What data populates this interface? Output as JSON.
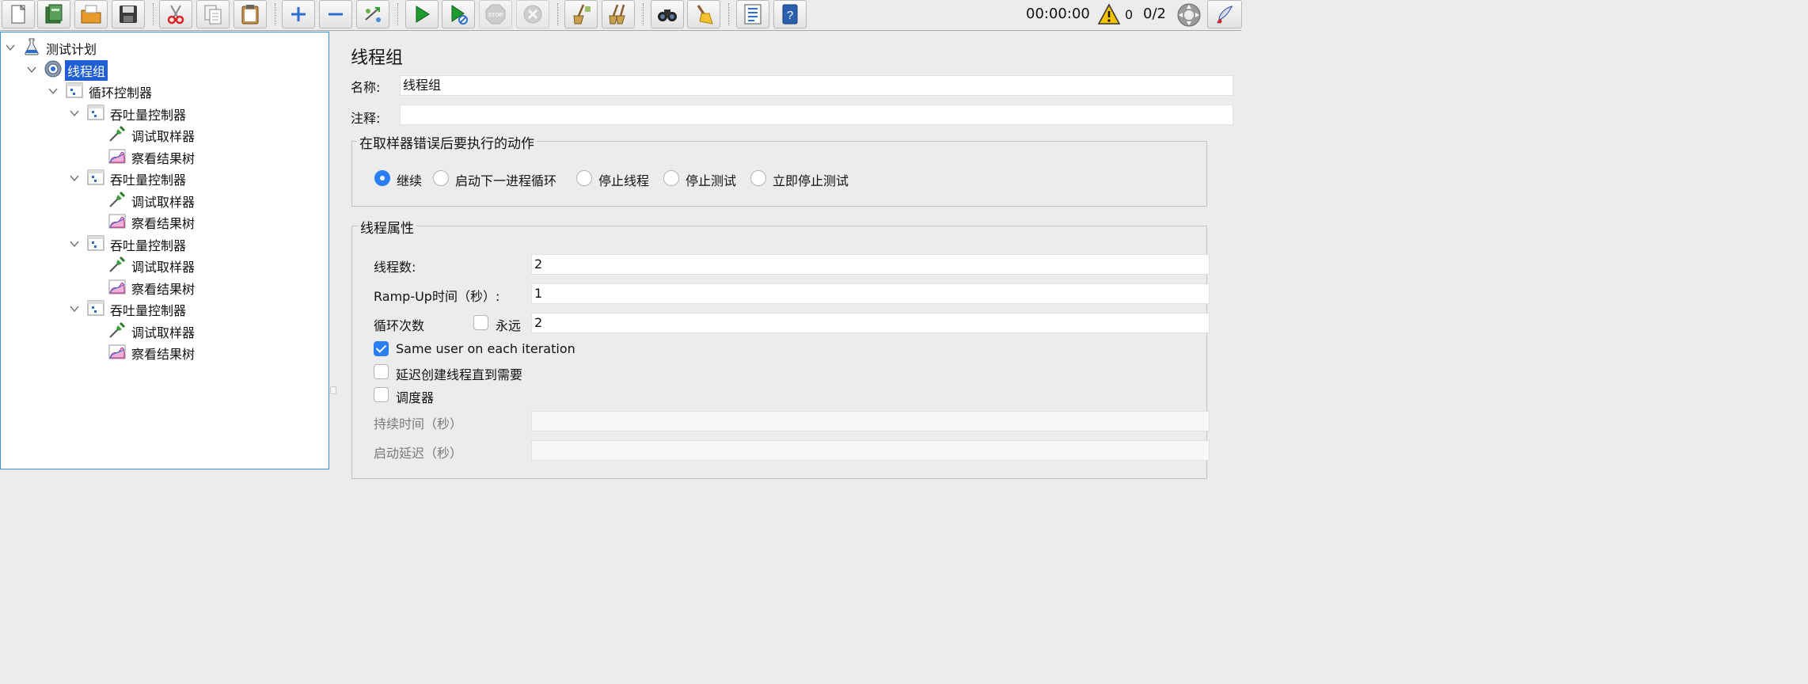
{
  "toolbar": {
    "buttons": [
      {
        "name": "new-icon"
      },
      {
        "name": "templates-icon"
      },
      {
        "name": "open-icon"
      },
      {
        "name": "save-icon"
      },
      {
        "name": "cut-icon"
      },
      {
        "name": "copy-icon"
      },
      {
        "name": "paste-icon"
      },
      {
        "name": "expand-icon"
      },
      {
        "name": "collapse-icon"
      },
      {
        "name": "toggle-icon"
      },
      {
        "name": "start-icon"
      },
      {
        "name": "start-no-pauses-icon"
      },
      {
        "name": "stop-icon",
        "label": "STOP",
        "disabled": true
      },
      {
        "name": "shutdown-icon",
        "disabled": true
      },
      {
        "name": "clear-icon"
      },
      {
        "name": "clear-all-icon"
      },
      {
        "name": "search-icon"
      },
      {
        "name": "reset-search-icon"
      },
      {
        "name": "function-helper-icon"
      },
      {
        "name": "help-icon"
      }
    ],
    "timer": "00:00:00",
    "warning_count": "0",
    "threads": "0/2"
  },
  "tree": {
    "nodes": [
      {
        "label": "测试计划",
        "icon": "test-plan-icon",
        "expanded": true
      },
      {
        "label": "线程组",
        "icon": "thread-group-icon",
        "expanded": true,
        "selected": true
      },
      {
        "label": "循环控制器",
        "icon": "controller-icon",
        "expanded": true
      },
      {
        "label": "吞吐量控制器",
        "icon": "controller-icon",
        "expanded": true
      },
      {
        "label": "调试取样器",
        "icon": "sampler-icon"
      },
      {
        "label": "察看结果树",
        "icon": "listener-icon"
      },
      {
        "label": "吞吐量控制器",
        "icon": "controller-icon",
        "expanded": true
      },
      {
        "label": "调试取样器",
        "icon": "sampler-icon"
      },
      {
        "label": "察看结果树",
        "icon": "listener-icon"
      },
      {
        "label": "吞吐量控制器",
        "icon": "controller-icon",
        "expanded": true
      },
      {
        "label": "调试取样器",
        "icon": "sampler-icon"
      },
      {
        "label": "察看结果树",
        "icon": "listener-icon"
      },
      {
        "label": "吞吐量控制器",
        "icon": "controller-icon",
        "expanded": true
      },
      {
        "label": "调试取样器",
        "icon": "sampler-icon"
      },
      {
        "label": "察看结果树",
        "icon": "listener-icon"
      }
    ]
  },
  "main": {
    "title": "线程组",
    "name_label": "名称:",
    "name_value": "线程组",
    "comment_label": "注释:",
    "comment_value": "",
    "error_group": {
      "title": "在取样器错误后要执行的动作",
      "options": [
        "继续",
        "启动下一进程循环",
        "停止线程",
        "停止测试",
        "立即停止测试"
      ],
      "selected": "继续"
    },
    "thread_group": {
      "title": "线程属性",
      "threads_label": "线程数:",
      "threads_value": "2",
      "rampup_label": "Ramp-Up时间（秒）:",
      "rampup_value": "1",
      "loop_label": "循环次数",
      "forever_label": "永远",
      "forever_checked": false,
      "loop_value": "2",
      "same_user_label": "Same user on each iteration",
      "same_user_checked": true,
      "delay_label": "延迟创建线程直到需要",
      "delay_checked": false,
      "scheduler_label": "调度器",
      "scheduler_checked": false,
      "duration_label": "持续时间（秒）",
      "duration_value": "",
      "startup_delay_label": "启动延迟（秒）",
      "startup_delay_value": ""
    }
  },
  "colors": {
    "accent": "#2a7ef5",
    "selection": "#1f5fd6",
    "tree_border": "#3d8ee5",
    "panel_bg": "#ececec"
  }
}
